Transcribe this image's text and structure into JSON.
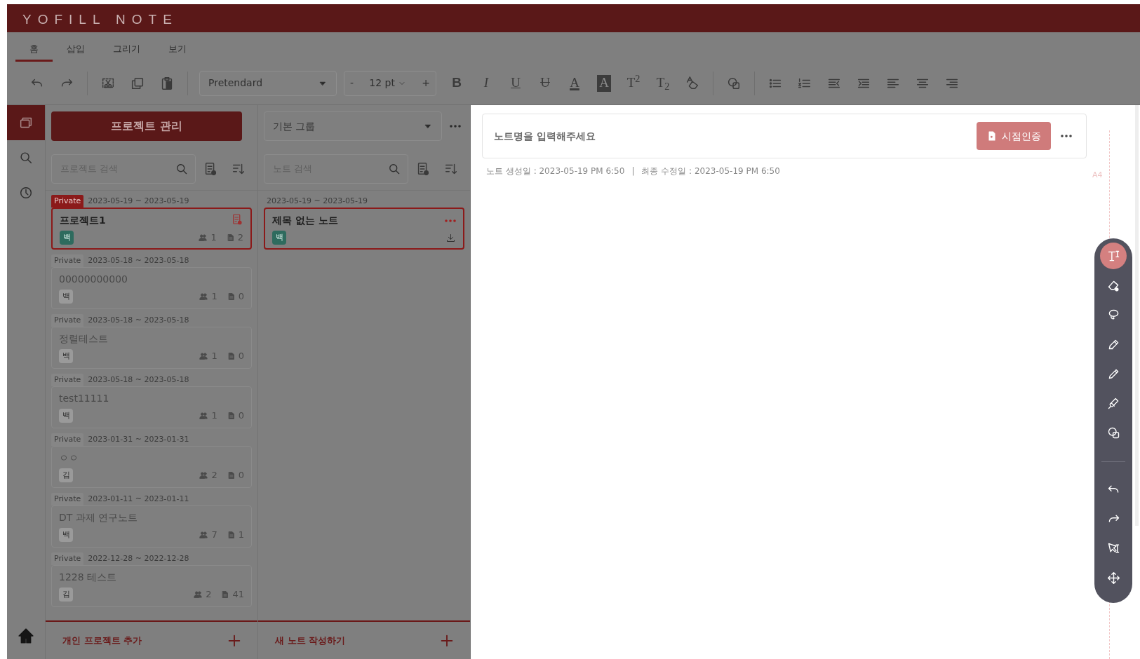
{
  "app_title": "YOFILL NOTE",
  "ribbon_tabs": [
    {
      "label": "홈",
      "selected": true
    },
    {
      "label": "삽입",
      "selected": false
    },
    {
      "label": "그리기",
      "selected": false
    },
    {
      "label": "보기",
      "selected": false
    }
  ],
  "toolbar": {
    "font_name": "Pretendard",
    "size_minus": "-",
    "font_size": "12 pt",
    "size_plus": "+",
    "format_buttons": [
      {
        "kind": "bold",
        "label": "B"
      },
      {
        "kind": "italic",
        "label": "I"
      },
      {
        "kind": "underline",
        "label": "U"
      },
      {
        "kind": "strike",
        "label": "U"
      },
      {
        "kind": "color",
        "label": "A"
      },
      {
        "kind": "highlight",
        "label": "A"
      },
      {
        "kind": "sup",
        "label": "T$^{2}$"
      },
      {
        "kind": "sub",
        "label": "T$_{2}$"
      }
    ]
  },
  "rail": [
    {
      "kind": "windows",
      "selected": true
    },
    {
      "kind": "search",
      "selected": false
    },
    {
      "kind": "clock",
      "selected": false
    }
  ],
  "projects_panel": {
    "manage_button": "프로젝트 관리",
    "search_placeholder": "프로젝트 검색",
    "projects": [
      {
        "visibility": "Private",
        "dates": "2023-05-19 ~ 2023-05-19",
        "title": "프로젝트1",
        "avatar": "백",
        "members": "1",
        "notes": "2",
        "selected": true
      },
      {
        "visibility": "Private",
        "dates": "2023-05-18 ~ 2023-05-18",
        "title": "00000000000",
        "avatar": "백",
        "members": "1",
        "notes": "0",
        "selected": false
      },
      {
        "visibility": "Private",
        "dates": "2023-05-18 ~ 2023-05-18",
        "title": "정렬테스트",
        "avatar": "백",
        "members": "1",
        "notes": "0",
        "selected": false
      },
      {
        "visibility": "Private",
        "dates": "2023-05-18 ~ 2023-05-18",
        "title": "test11111",
        "avatar": "백",
        "members": "1",
        "notes": "0",
        "selected": false
      },
      {
        "visibility": "Private",
        "dates": "2023-01-31 ~ 2023-01-31",
        "title": "ㅇㅇ",
        "avatar": "김",
        "members": "2",
        "notes": "0",
        "selected": false
      },
      {
        "visibility": "Private",
        "dates": "2023-01-11 ~ 2023-01-11",
        "title": "DT 과제 연구노트",
        "avatar": "백",
        "members": "7",
        "notes": "1",
        "selected": false
      },
      {
        "visibility": "Private",
        "dates": "2022-12-28 ~ 2022-12-28",
        "title": "1228 테스트",
        "avatar": "김",
        "members": "2",
        "notes": "41",
        "selected": false
      }
    ],
    "add_button": "개인 프로젝트 추가"
  },
  "notes_panel": {
    "group_select": "기본 그룹",
    "search_placeholder": "노트 검색",
    "notes": [
      {
        "dates": "2023-05-19 ~ 2023-05-19",
        "title": "제목 없는 노트",
        "avatar": "백",
        "selected": true
      }
    ],
    "add_button": "새 노트 작성하기"
  },
  "editor": {
    "title_placeholder": "노트명을 입력해주세요",
    "cert_button": "시점인증",
    "created": "노트 생성일 : 2023-05-19 PM 6:50",
    "separator": "|",
    "modified": "최종 수정일 : 2023-05-19 PM 6:50",
    "page_size": "A4"
  },
  "draw_tools": [
    {
      "kind": "text",
      "selected": true
    },
    {
      "kind": "eraser",
      "selected": false
    },
    {
      "kind": "lasso",
      "selected": false
    },
    {
      "kind": "pen",
      "selected": false
    },
    {
      "kind": "pencil",
      "selected": false
    },
    {
      "kind": "highlighter",
      "selected": false
    },
    {
      "kind": "shape",
      "selected": false
    },
    {
      "kind": "divider"
    },
    {
      "kind": "undo",
      "selected": false
    },
    {
      "kind": "redo",
      "selected": false
    },
    {
      "kind": "select",
      "selected": false
    },
    {
      "kind": "move",
      "selected": false
    }
  ]
}
